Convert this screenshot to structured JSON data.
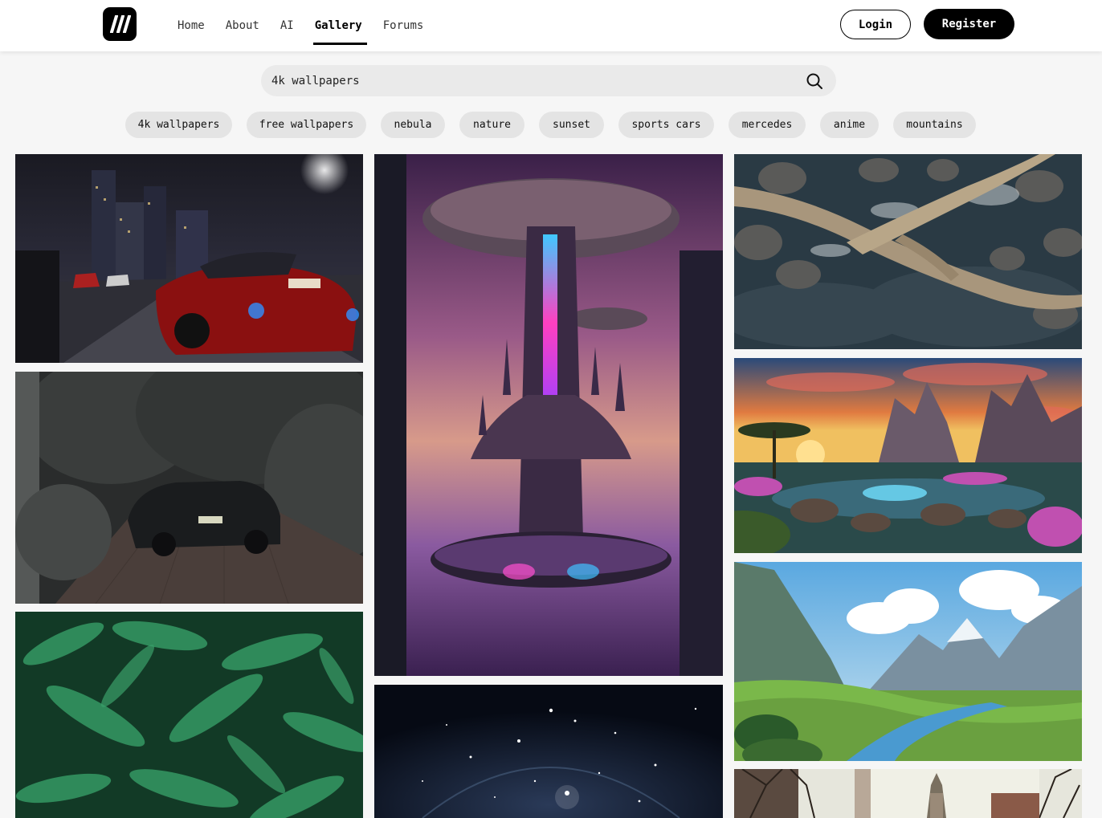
{
  "header": {
    "logo_icon": "brand-logo-icon",
    "nav": [
      {
        "label": "Home",
        "active": false
      },
      {
        "label": "About",
        "active": false
      },
      {
        "label": "AI",
        "active": false
      },
      {
        "label": "Gallery",
        "active": true
      },
      {
        "label": "Forums",
        "active": false
      }
    ],
    "login_label": "Login",
    "register_label": "Register"
  },
  "search": {
    "value": "4k wallpapers",
    "icon": "search-icon"
  },
  "tags": [
    "4k wallpapers",
    "free wallpapers",
    "nebula",
    "nature",
    "sunset",
    "sports cars",
    "mercedes",
    "anime",
    "mountains"
  ],
  "gallery": [
    {
      "name": "wallpaper-neon-city-car",
      "subject": "red sports car in neon city at night"
    },
    {
      "name": "wallpaper-futuristic-tower",
      "subject": "futuristic mushroom tower city"
    },
    {
      "name": "wallpaper-driftwood-river",
      "subject": "driftwood over river rocks"
    },
    {
      "name": "wallpaper-black-car-driveway",
      "subject": "black car in tree-lined driveway"
    },
    {
      "name": "wallpaper-fantasy-sunset",
      "subject": "fantasy landscape at sunset"
    },
    {
      "name": "wallpaper-green-leaves",
      "subject": "green fern leaves"
    },
    {
      "name": "wallpaper-space-stars",
      "subject": "starry space"
    },
    {
      "name": "wallpaper-mountain-valley",
      "subject": "mountain valley with river"
    },
    {
      "name": "wallpaper-winter-tower",
      "subject": "tower behind bare trees"
    }
  ]
}
